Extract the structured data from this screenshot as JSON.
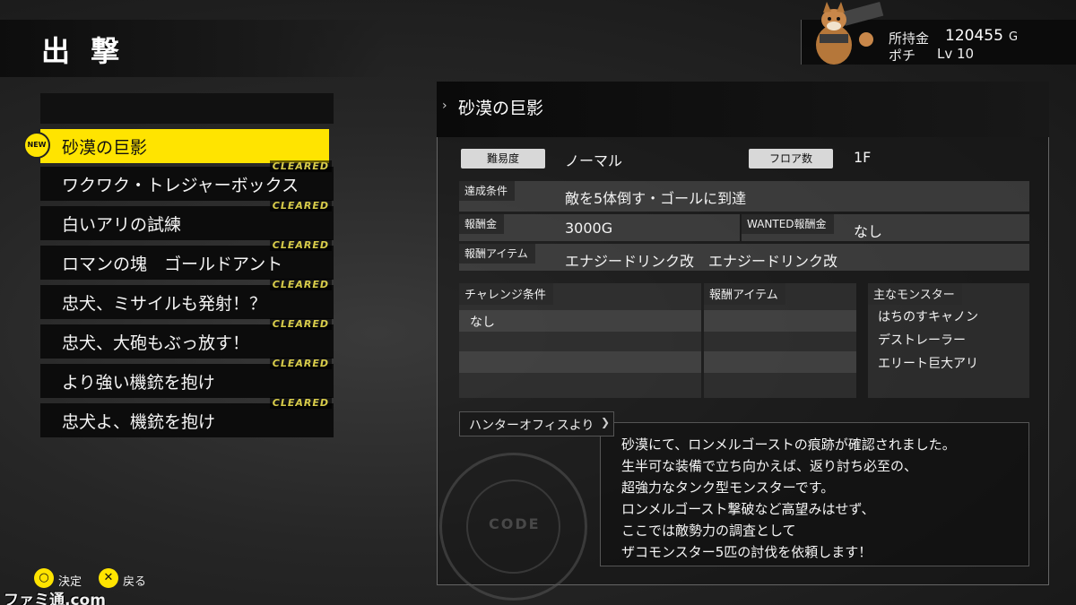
{
  "header": {
    "title": "出 撃"
  },
  "wallet": {
    "money_label": "所持金",
    "money_value": "120455",
    "money_unit": "G",
    "pet_name": "ポチ",
    "pet_level": "Lv 10"
  },
  "missions": [
    {
      "label": "砂漠の巨影",
      "badge": "NEW",
      "selected": true
    },
    {
      "label": "ワクワク・トレジャーボックス",
      "cleared": "CLEARED"
    },
    {
      "label": "白いアリの試練",
      "cleared": "CLEARED"
    },
    {
      "label": "ロマンの塊　ゴールドアント",
      "cleared": "CLEARED"
    },
    {
      "label": "忠犬、ミサイルも発射！？",
      "cleared": "CLEARED"
    },
    {
      "label": "忠犬、大砲もぶっ放す！",
      "cleared": "CLEARED"
    },
    {
      "label": "より強い機銃を抱け",
      "cleared": "CLEARED"
    },
    {
      "label": "忠犬よ、機銃を抱け",
      "cleared": "CLEARED"
    }
  ],
  "detail": {
    "title": "砂漠の巨影",
    "difficulty_label": "難易度",
    "difficulty_value": "ノーマル",
    "floor_label": "フロア数",
    "floor_value": "1F",
    "goal_label": "達成条件",
    "goal_value": "敵を5体倒す・ゴールに到達",
    "reward_label": "報酬金",
    "reward_value": "3000G",
    "wanted_label": "WANTED報酬金",
    "wanted_value": "なし",
    "item_label": "報酬アイテム",
    "item_value": "エナジードリンク改　エナジードリンク改",
    "challenge_label": "チャレンジ条件",
    "challenge_value": "なし",
    "challenge_item_label": "報酬アイテム",
    "monster_label": "主なモンスター",
    "monsters": [
      "はちのすキャノン",
      "デストレーラー",
      "エリート巨大アリ"
    ]
  },
  "office": {
    "tab_label": "ハンターオフィスより",
    "stamp_text": "CODE",
    "message_lines": [
      "砂漠にて、ロンメルゴーストの痕跡が確認されました。",
      "生半可な装備で立ち向かえば、返り討ち必至の、",
      "超強力なタンク型モンスターです。",
      "ロンメルゴースト撃破など高望みはせず、",
      "ここでは敵勢力の調査として",
      "ザコモンスター5匹の討伐を依頼します！"
    ]
  },
  "controls": {
    "confirm_glyph": "○",
    "confirm_label": "決定",
    "back_glyph": "✕",
    "back_label": "戻る"
  },
  "watermark": "ファミ通.com",
  "colors": {
    "accent": "#ffe400",
    "cleared": "#d8cc4a"
  }
}
